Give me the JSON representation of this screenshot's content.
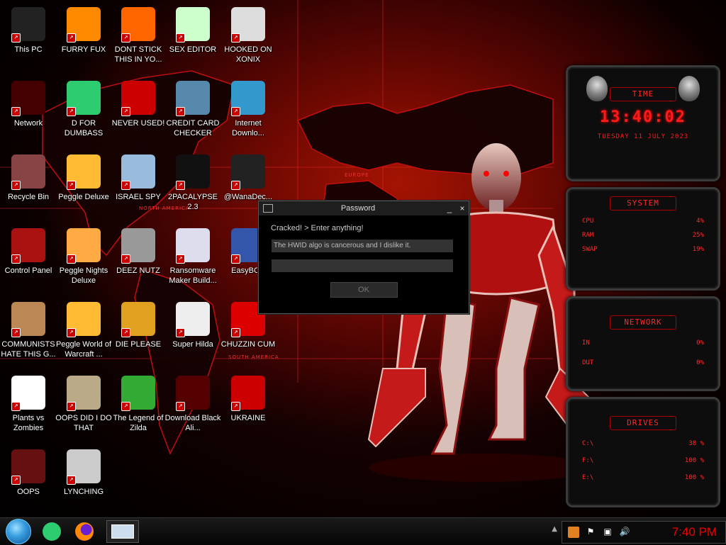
{
  "desktop": {
    "icons": [
      {
        "label": "This PC",
        "icon": "this-pc-icon"
      },
      {
        "label": "FURRY FUX",
        "icon": "firefox-icon"
      },
      {
        "label": "DONT STICK THIS IN YO...",
        "icon": "vlc-cone-icon"
      },
      {
        "label": "SEX EDITOR",
        "icon": "hxd-icon"
      },
      {
        "label": "HOOKED ON XONIX",
        "icon": "xonix-icon"
      },
      {
        "label": "Network",
        "icon": "network-icon"
      },
      {
        "label": "D FOR DUMBASS",
        "icon": "chat-bubble-icon"
      },
      {
        "label": "NEVER USED!",
        "icon": "dev-cpp-icon"
      },
      {
        "label": "CREDIT CARD CHECKER",
        "icon": "credit-card-icon"
      },
      {
        "label": "Internet Downlo...",
        "icon": "download-globe-icon"
      },
      {
        "label": "Recycle Bin",
        "icon": "recycle-bin-icon"
      },
      {
        "label": "Peggle Deluxe",
        "icon": "peggle-icon"
      },
      {
        "label": "ISRAEL SPY",
        "icon": "spy-tool-icon"
      },
      {
        "label": "2PACALYPSE 2.3",
        "icon": "terminal-icon"
      },
      {
        "label": "@WanaDec...",
        "icon": "wanadec-icon"
      },
      {
        "label": "Control Panel",
        "icon": "control-panel-icon"
      },
      {
        "label": "Peggle Nights Deluxe",
        "icon": "peggle-nights-icon"
      },
      {
        "label": "DEEZ NUTZ",
        "icon": "stacked-windows-icon"
      },
      {
        "label": "Ransomware Maker Build...",
        "icon": "ransomware-builder-icon"
      },
      {
        "label": "EasyBCD",
        "icon": "easybcd-icon"
      },
      {
        "label": "COMMUNISTS HATE THIS G...",
        "icon": "money-bag-icon"
      },
      {
        "label": "Peggle World of Warcraft ...",
        "icon": "peggle-wow-icon"
      },
      {
        "label": "DIE PLEASE",
        "icon": "de-icon"
      },
      {
        "label": "Super Hilda",
        "icon": "pixel-dog-icon"
      },
      {
        "label": "CHUZZIN CUM",
        "icon": "chuzzle-icon"
      },
      {
        "label": "Plants vs Zombies",
        "icon": "flower-icon"
      },
      {
        "label": "OOPS DID I DO THAT",
        "icon": "portrait-icon"
      },
      {
        "label": "The Legend of Zilda",
        "icon": "pixel-hero-icon"
      },
      {
        "label": "Download Black Ali...",
        "icon": "alien-red-icon"
      },
      {
        "label": "UKRAINE",
        "icon": "radiation-icon"
      },
      {
        "label": "OOPS",
        "icon": "skull-box-icon"
      },
      {
        "label": "LYNCHING",
        "icon": "hex-molecule-icon"
      }
    ]
  },
  "wallpaper": {
    "map_labels": [
      "EUROPE",
      "NORTH AMERICA",
      "SOUTH AMERICA"
    ]
  },
  "widgets": {
    "time": {
      "title": "TIME",
      "clock": "13:40:02",
      "date": "TUESDAY 11 JULY 2023"
    },
    "system": {
      "title": "SYSTEM",
      "rows": [
        {
          "name": "CPU",
          "value": "4%"
        },
        {
          "name": "RAM",
          "value": "25%"
        },
        {
          "name": "SWAP",
          "value": "19%"
        }
      ]
    },
    "network": {
      "title": "NETWORK",
      "rows": [
        {
          "name": "IN",
          "value": "0%"
        },
        {
          "name": "OUT",
          "value": "0%"
        }
      ]
    },
    "drives": {
      "title": "DRIVES",
      "rows": [
        {
          "name": "C:\\",
          "value": "38 %"
        },
        {
          "name": "F:\\",
          "value": "100 %"
        },
        {
          "name": "E:\\",
          "value": "100 %"
        }
      ]
    }
  },
  "dialog": {
    "title": "Password",
    "minimize": "_",
    "close": "×",
    "message": "Cracked! > Enter anything!",
    "field1_value": "The HWID algo is cancerous and I dislike it.",
    "field2_value": "",
    "ok_label": "OK"
  },
  "taskbar": {
    "tray_time": "7:40 PM",
    "pinned": [
      "chat-bubble-icon",
      "firefox-icon",
      "window-preview-icon"
    ]
  },
  "colors": {
    "accent": "#ff1a1a",
    "taskbar": "#0a0a0a",
    "dialog_bg": "#000000"
  }
}
